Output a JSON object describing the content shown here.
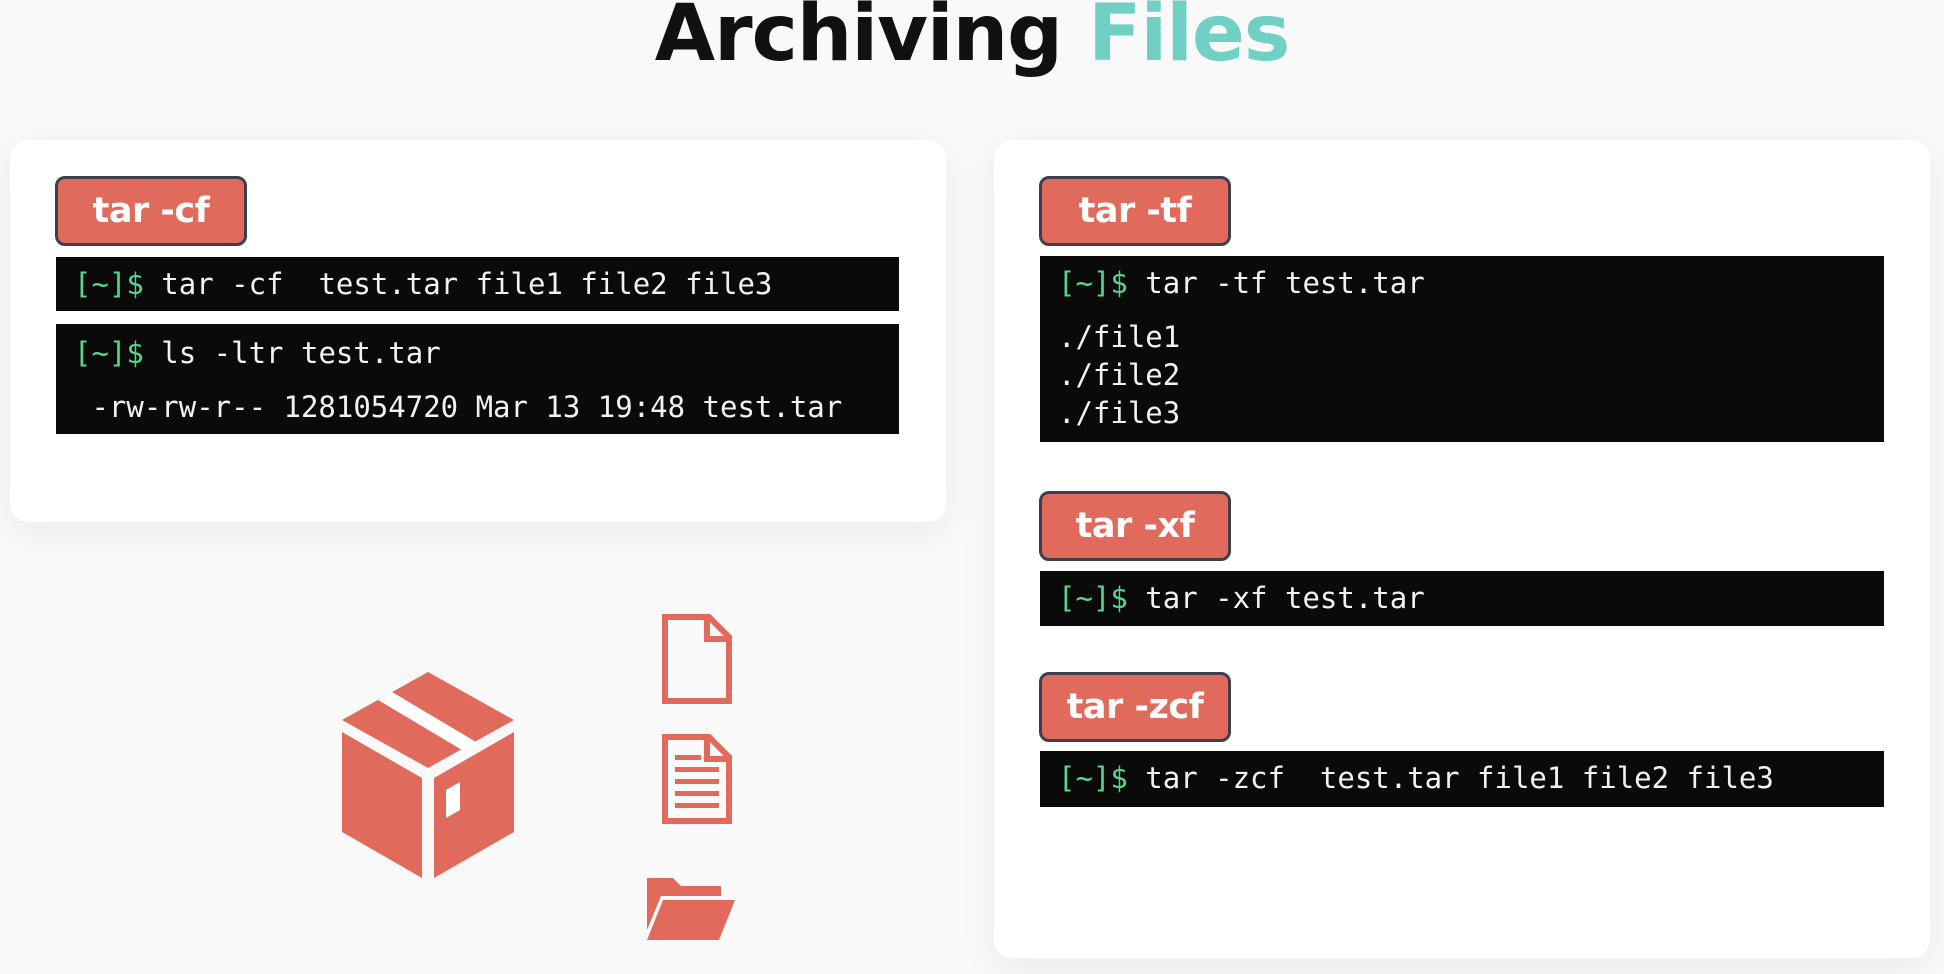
{
  "title": {
    "main": "Archiving ",
    "accent": "Files"
  },
  "colors": {
    "accent_teal": "#6fd0c3",
    "badge_red": "#e06b5d",
    "badge_border": "#3d3f4f",
    "prompt_green": "#54d98c",
    "terminal_bg": "#0a0a0a"
  },
  "prompt": "[~]$",
  "left": {
    "badge": "tar -cf",
    "cmd1": " tar -cf  test.tar file1 file2 file3",
    "cmd2": " ls -ltr test.tar",
    "cmd2_output": " -rw-rw-r-- 1281054720 Mar 13 19:48 test.tar"
  },
  "right": {
    "tf": {
      "badge": "tar -tf",
      "cmd": " tar -tf test.tar",
      "outputs": [
        "./file1",
        "./file2",
        "./file3"
      ]
    },
    "xf": {
      "badge": "tar -xf",
      "cmd": " tar -xf test.tar"
    },
    "zcf": {
      "badge": "tar -zcf",
      "cmd": " tar -zcf  test.tar file1 file2 file3"
    }
  },
  "icons": [
    "package-box-icon",
    "blank-file-icon",
    "text-file-icon",
    "open-folder-icon"
  ]
}
